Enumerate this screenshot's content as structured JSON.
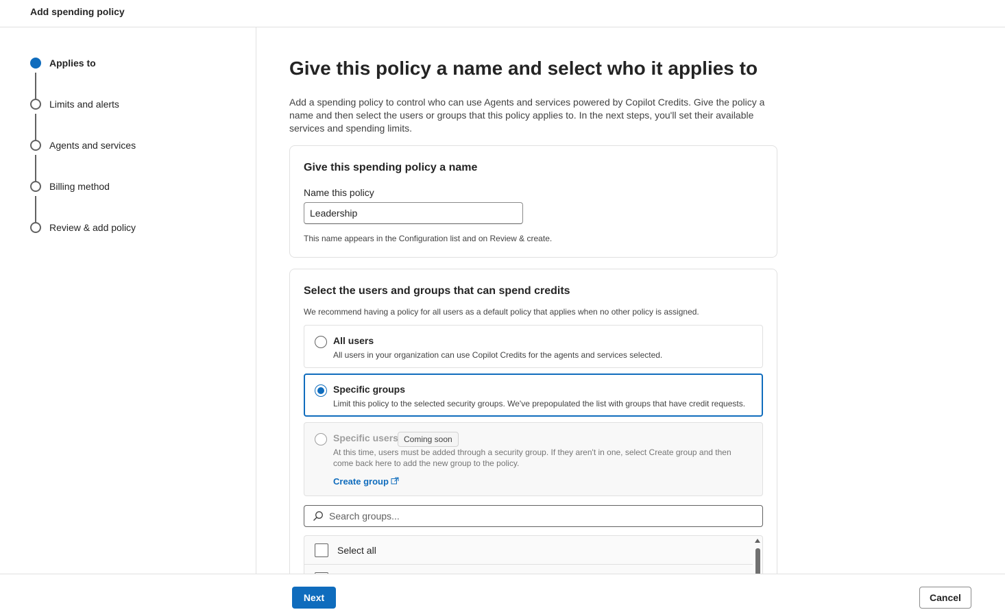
{
  "header": {
    "title": "Add spending policy"
  },
  "steps": [
    {
      "label": "Applies to",
      "active": true
    },
    {
      "label": "Limits and alerts",
      "active": false
    },
    {
      "label": "Agents and services",
      "active": false
    },
    {
      "label": "Billing method",
      "active": false
    },
    {
      "label": "Review & add policy",
      "active": false
    }
  ],
  "main": {
    "heading": "Give this policy a name and select who it applies to",
    "intro": "Add a spending policy to control who can use Agents and services powered by Copilot Credits. Give the policy a name and then select the users or groups that this policy applies to. In the next steps, you'll set their available services and spending limits."
  },
  "name_card": {
    "title": "Give this spending policy a name",
    "field_label": "Name this policy",
    "field_value": "Leadership",
    "hint": "This name appears in the Configuration list and on Review & create."
  },
  "users_card": {
    "title": "Select the users and groups that can spend credits",
    "hint": "We recommend having a policy for all users as a default policy that applies when no other policy is assigned.",
    "options": [
      {
        "title": "All users",
        "description": "All users in your organization can use Copilot Credits for the agents and services selected.",
        "selected": false
      },
      {
        "title": "Specific groups",
        "description": "Limit this policy to the selected security groups. We've prepopulated the list with groups that have credit requests.",
        "selected": true
      },
      {
        "title": "Specific users",
        "badge": "Coming soon",
        "description": "At this time, users must be added through a security group. If they aren't in one, select Create group and then come back here to add the new group to the policy.",
        "link": "Create group",
        "selected": false,
        "disabled": true
      }
    ],
    "search_placeholder": "Search groups...",
    "select_all_label": "Select all"
  },
  "footer": {
    "next_label": "Next",
    "cancel_label": "Cancel"
  },
  "colors": {
    "accent": "#0f6cbd",
    "border": "#e0e0e0",
    "text": "#242424"
  }
}
